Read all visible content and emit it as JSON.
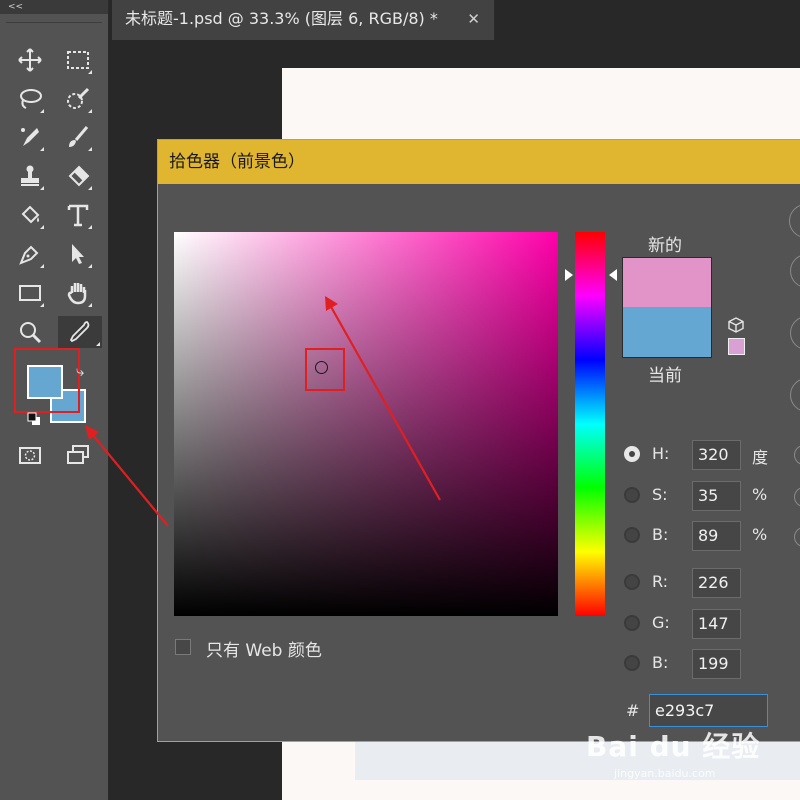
{
  "toolbar": {
    "collapse_label": "<<",
    "tools": [
      "move-icon",
      "marquee-icon",
      "lasso-icon",
      "quick-select-icon",
      "spot-heal-icon",
      "brush-icon",
      "stamp-icon",
      "eraser-icon",
      "paint-bucket-icon",
      "type-icon",
      "pen-icon",
      "path-select-icon",
      "rectangle-icon",
      "hand-icon",
      "zoom-icon",
      "eyedropper-icon"
    ],
    "foreground_color": "#66a7d1",
    "background_color": "#66a7d1"
  },
  "document_tab": {
    "title": "未标题-1.psd @ 33.3% (图层 6, RGB/8) *",
    "close": "✕"
  },
  "color_picker": {
    "title": "拾色器（前景色）",
    "new_label": "新的",
    "current_label": "当前",
    "new_color": "#e293c7",
    "current_color": "#63a7d2",
    "hue_color": "#ff00aa",
    "fields": {
      "h": {
        "label": "H:",
        "value": "320",
        "unit": "度"
      },
      "s": {
        "label": "S:",
        "value": "35",
        "unit": "%"
      },
      "b": {
        "label": "B:",
        "value": "89",
        "unit": "%"
      },
      "r": {
        "label": "R:",
        "value": "226"
      },
      "g": {
        "label": "G:",
        "value": "147"
      },
      "b2": {
        "label": "B:",
        "value": "199"
      }
    },
    "hex_label": "#",
    "hex_value": "e293c7",
    "web_only_label": "只有 Web 颜色"
  },
  "watermark": {
    "brand": "Bai du 经验",
    "url": "jingyan.baidu.com"
  },
  "annotation_color": "#e02020"
}
